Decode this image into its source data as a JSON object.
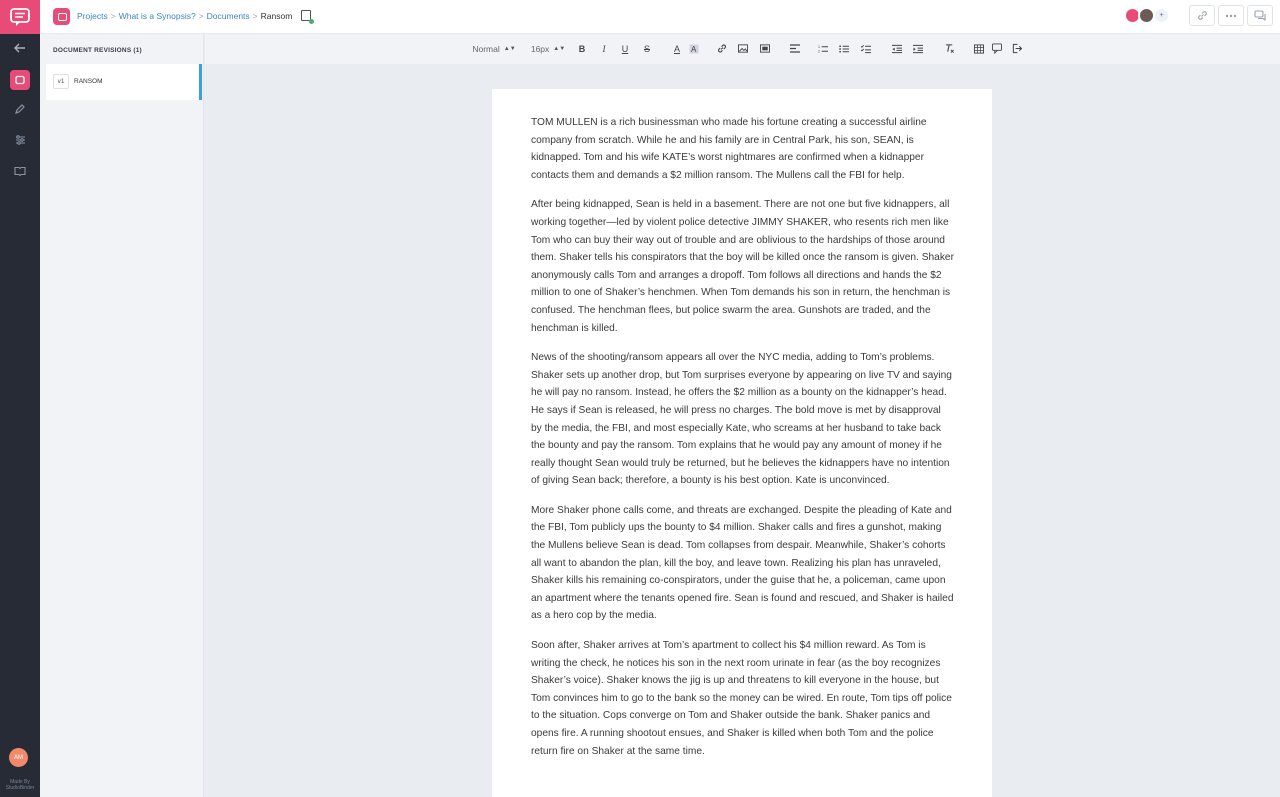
{
  "breadcrumbs": {
    "items": [
      "Projects",
      "What is a Synopsis?",
      "Documents"
    ],
    "current": "Ransom"
  },
  "topbar": {
    "avatar_count_label": "+"
  },
  "rail": {
    "avatar_initials": "AM",
    "made_by": "Made By",
    "made_by_brand": "StudioBinder"
  },
  "revisions": {
    "title": "DOCUMENT REVISIONS (1)",
    "items": [
      {
        "version": "v1",
        "name": "RANSOM"
      }
    ]
  },
  "toolbar": {
    "block_format": "Normal",
    "font_size": "16px",
    "tools": [
      "bold",
      "italic",
      "underline",
      "strikethrough",
      "text-color",
      "highlight",
      "link",
      "image",
      "video",
      "align",
      "ordered-list",
      "bullet-list",
      "checklist",
      "outdent",
      "indent",
      "clear-format",
      "table",
      "comment",
      "export"
    ]
  },
  "document": {
    "paragraphs": [
      "TOM MULLEN is a rich businessman who made his fortune creating a successful airline company from scratch. While he and his family are in Central Park, his son, SEAN, is kidnapped. Tom and his wife KATE’s worst nightmares are confirmed when a kidnapper contacts them and demands a $2 million ransom. The Mullens call the FBI for help.",
      "After being kidnapped, Sean is held in a basement. There are not one but five kidnappers, all working together—led by violent police detective JIMMY SHAKER, who resents rich men like Tom who can buy their way out of trouble and are oblivious to the hardships of those around them. Shaker tells his conspirators that the boy will be killed once the ransom is given. Shaker anonymously calls Tom and arranges a dropoff. Tom follows all directions and hands the $2 million to one of Shaker’s henchmen. When Tom demands his son in return, the henchman is confused. The henchman flees, but police swarm the area. Gunshots are traded, and the henchman is killed.",
      "News of the shooting/ransom appears all over the NYC media, adding to Tom’s problems. Shaker sets up another drop, but Tom surprises everyone by appearing on live TV and saying he will pay no ransom. Instead, he offers the $2 million as a bounty on the kidnapper’s head. He says if Sean is released, he will press no charges. The bold move is met by disapproval by the media, the FBI, and most especially Kate, who screams at her husband to take back the bounty and pay the ransom. Tom explains that he would pay any amount of money if he really thought Sean would truly be returned, but he believes the kidnappers have no intention of giving Sean back; therefore, a bounty is his best option. Kate is unconvinced.",
      "More Shaker phone calls come, and threats are exchanged. Despite the pleading of Kate and the FBI, Tom publicly ups the bounty to $4 million. Shaker calls and fires a gunshot, making the Mullens believe Sean is dead. Tom collapses from despair. Meanwhile, Shaker’s cohorts all want to abandon the plan, kill the boy, and leave town. Realizing his plan has unraveled, Shaker kills his remaining co-conspirators, under the guise that he, a policeman, came upon an apartment where the tenants opened fire. Sean is found and rescued, and Shaker is hailed as a hero cop by the media.",
      "Soon after, Shaker arrives at Tom’s apartment to collect his $4 million reward. As Tom is writing the check, he notices his son in the next room urinate in fear (as the boy recognizes Shaker’s voice). Shaker knows the jig is up and threatens to kill everyone in the house, but Tom convinces him to go to the bank so the money can be wired. En route, Tom tips off police to the situation. Cops converge on Tom and Shaker outside the bank. Shaker panics and opens fire. A running shootout ensues, and Shaker is killed when both Tom and the police return fire on Shaker at the same time."
    ]
  }
}
